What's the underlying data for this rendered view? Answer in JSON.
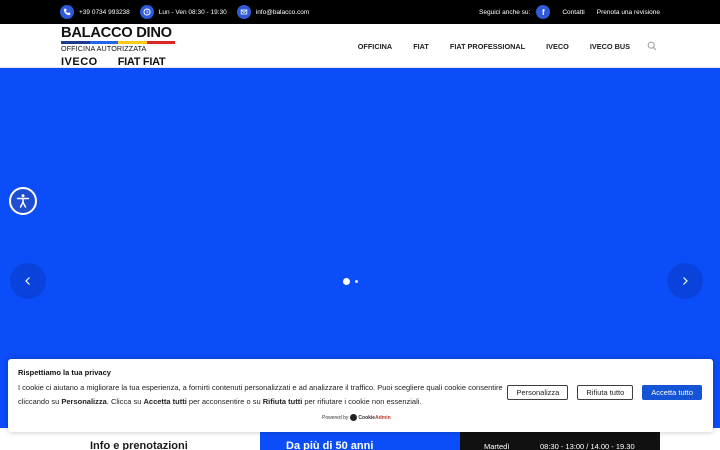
{
  "topbar": {
    "phone": "+39 0734 993238",
    "hours": "Lun - Ven 08:30 - 19:30",
    "email": "info@balacco.com",
    "follow_label": "Seguici anche su:",
    "facebook_glyph": "f",
    "contacts_link": "Contatti",
    "revision_link": "Prenota una revisione"
  },
  "logo": {
    "title": "BALACCO DINO",
    "subtitle": "OFFICINA AUTORIZZATA",
    "brand_iveco": "IVECO",
    "brand_fiat": "FIAT FIAT",
    "stripe_colors": [
      "#1e3a8a",
      "#2563eb",
      "#facc15",
      "#dc2626"
    ]
  },
  "nav": {
    "items": [
      "OFFICINA",
      "FIAT",
      "FIAT PROFESSIONAL",
      "IVECO",
      "IVECO BUS"
    ],
    "search_icon": "search-icon"
  },
  "hero": {
    "background": "#0c4dfa",
    "slide_count": 2,
    "active_slide": 1
  },
  "strips": {
    "info": "Info e prenotazioni",
    "years": "Da più di 50 anni",
    "day": "Martedì",
    "hours": "08:30 - 13:00 / 14.00 - 19.30"
  },
  "cookie": {
    "title": "Rispettiamo la tua privacy",
    "text_1": "I cookie ci aiutano a migliorare la tua esperienza, a fornirti contenuti personalizzati e ad analizzare il traffico. Puoi scegliere quali cookie consentire cliccando su ",
    "bold_1": "Personalizza",
    "text_2": ". Clicca su ",
    "bold_2": "Accetta tutti",
    "text_3": " per acconsentire o su ",
    "bold_3": "Rifiuta tutti",
    "text_4": " per rifiutare i cookie non essenziali.",
    "btn_customize": "Personalizza",
    "btn_reject": "Rifiuta tutto",
    "btn_accept": "Accetta tutto",
    "powered_by": "Powered by",
    "powered_brand_a": "Cookie",
    "powered_brand_b": "Admin"
  }
}
